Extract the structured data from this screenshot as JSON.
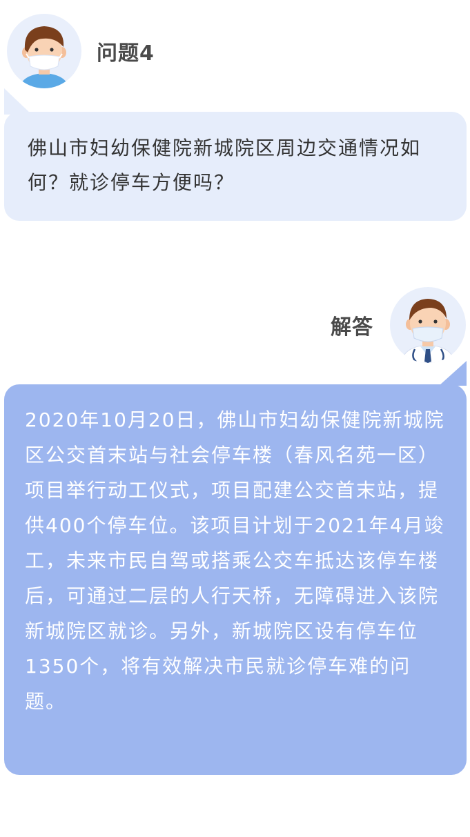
{
  "question": {
    "label": "问题4",
    "avatar_icon": "patient-masked-avatar-icon",
    "text": "佛山市妇幼保健院新城院区周边交通情况如何？就诊停车方便吗？"
  },
  "answer": {
    "label": "解答",
    "avatar_icon": "doctor-masked-avatar-icon",
    "text": "2020年10月20日，佛山市妇幼保健院新城院区公交首末站与社会停车楼（春风名苑一区）项目举行动工仪式，项目配建公交首末站，提供400个停车位。该项目计划于2021年4月竣工，未来市民自驾或搭乘公交车抵达该停车楼后，可通过二层的人行天桥，无障碍进入该院新城院区就诊。另外，新城院区设有停车位1350个，将有效解决市民就诊停车难的问题。"
  },
  "colors": {
    "question_bubble": "#e6edfb",
    "answer_bubble": "#9db6ef",
    "label_text": "#4a4a4a"
  }
}
